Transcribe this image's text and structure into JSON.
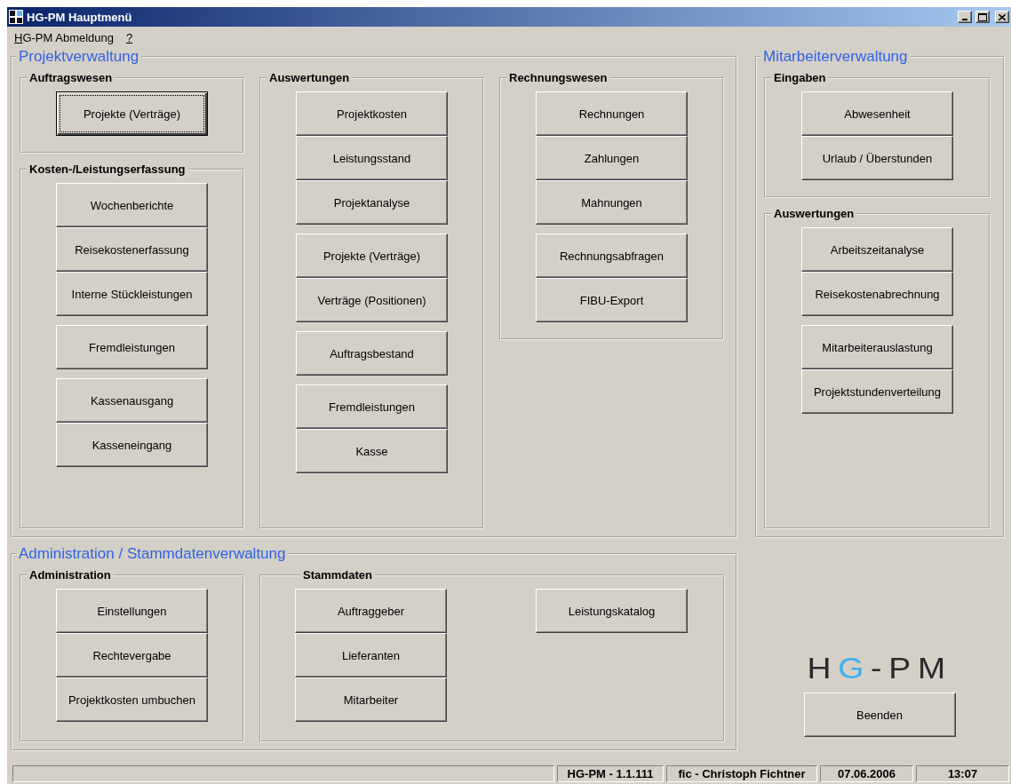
{
  "window": {
    "title": "HG-PM Hauptmenü"
  },
  "menu": [
    {
      "label": "HG-PM Abmeldung"
    },
    {
      "label": "?"
    }
  ],
  "projektverwaltung": {
    "title": "Projektverwaltung",
    "columns": [
      [
        {
          "title": "Auftragswesen",
          "columns": [
            [
              [
                {
                  "label": "Projekte (Verträge)",
                  "focused": true
                }
              ]
            ]
          ]
        },
        {
          "title": "Kosten-/Leistungserfassung",
          "columns": [
            [
              [
                {
                  "label": "Wochenberichte",
                  "focused": false
                },
                {
                  "label": "Reisekostenerfassung",
                  "focused": false
                },
                {
                  "label": "Interne Stückleistungen",
                  "focused": false
                }
              ],
              [
                {
                  "label": "Fremdleistungen",
                  "focused": false
                }
              ],
              [
                {
                  "label": "Kassenausgang",
                  "focused": false
                },
                {
                  "label": "Kasseneingang",
                  "focused": false
                }
              ]
            ]
          ]
        }
      ],
      [
        {
          "title": "Auswertungen",
          "columns": [
            [
              [
                {
                  "label": "Projektkosten",
                  "focused": false
                },
                {
                  "label": "Leistungsstand",
                  "focused": false
                },
                {
                  "label": "Projektanalyse",
                  "focused": false
                }
              ],
              [
                {
                  "label": "Projekte (Verträge)",
                  "focused": false
                },
                {
                  "label": "Verträge (Positionen)",
                  "focused": false
                }
              ],
              [
                {
                  "label": "Auftragsbestand",
                  "focused": false
                }
              ],
              [
                {
                  "label": "Fremdleistungen",
                  "focused": false
                },
                {
                  "label": "Kasse",
                  "focused": false
                }
              ]
            ]
          ]
        }
      ],
      [
        {
          "title": "Rechnungswesen",
          "columns": [
            [
              [
                {
                  "label": "Rechnungen",
                  "focused": false
                },
                {
                  "label": "Zahlungen",
                  "focused": false
                },
                {
                  "label": "Mahnungen",
                  "focused": false
                }
              ],
              [
                {
                  "label": "Rechnungsabfragen",
                  "focused": false
                },
                {
                  "label": "FIBU-Export",
                  "focused": false
                }
              ]
            ]
          ]
        }
      ]
    ]
  },
  "mitarbeiterverwaltung": {
    "title": "Mitarbeiterverwaltung",
    "boxes": [
      {
        "title": "Eingaben",
        "columns": [
          [
            [
              {
                "label": "Abwesenheit",
                "focused": false
              },
              {
                "label": "Urlaub / Überstunden",
                "focused": false
              }
            ]
          ]
        ]
      },
      {
        "title": "Auswertungen",
        "columns": [
          [
            [
              {
                "label": "Arbeitszeitanalyse",
                "focused": false
              },
              {
                "label": "Reisekostenabrechnung",
                "focused": false
              }
            ],
            [
              {
                "label": "Mitarbeiterauslastung",
                "focused": false
              },
              {
                "label": "Projektstundenverteilung",
                "focused": false
              }
            ]
          ]
        ]
      }
    ]
  },
  "administration": {
    "title": "Administration / Stammdatenverwaltung",
    "boxes": [
      {
        "title": "Administration",
        "columns": [
          [
            [
              {
                "label": "Einstellungen",
                "focused": false
              },
              {
                "label": "Rechtevergabe",
                "focused": false
              },
              {
                "label": "Projektkosten umbuchen",
                "focused": false
              }
            ]
          ]
        ]
      },
      {
        "title": "Stammdaten",
        "columns": [
          [
            [
              {
                "label": "Auftraggeber",
                "focused": false
              },
              {
                "label": "Lieferanten",
                "focused": false
              },
              {
                "label": "Mitarbeiter",
                "focused": false
              }
            ]
          ],
          [
            [
              {
                "label": "Leistungskatalog",
                "focused": false
              }
            ]
          ]
        ]
      }
    ]
  },
  "logo": "HG-PM",
  "exit_button": {
    "label": "Beenden",
    "focused": false
  },
  "status_bar": {
    "panels": [
      "HG-PM - 1.1.111",
      "fic - Christoph Fichtner",
      "07.06.2006",
      "13:07"
    ]
  }
}
